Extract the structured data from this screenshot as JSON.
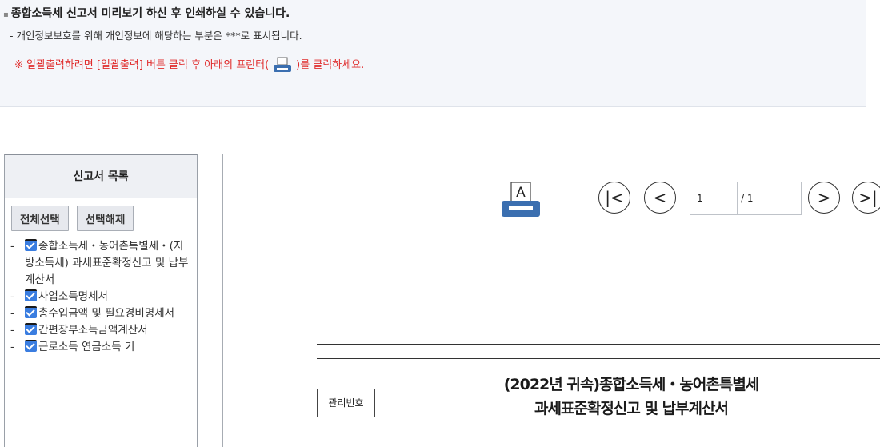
{
  "notice": {
    "bullet": "▪",
    "line1": "종합소득세 신고서 미리보기 하신 후 인쇄하실 수 있습니다.",
    "line2": "- 개인정보보호를 위해 개인정보에 해당하는 부분은  ***로 표시됩니다.",
    "line3_before": "※ 일괄출력하려면 [일괄출력] 버튼 클릭 후 아래의 프린터(",
    "line3_after": ")를 클릭하세요."
  },
  "sidebar": {
    "title": "신고서 목록",
    "select_all": "전체선택",
    "deselect_all": "선택해제",
    "items": [
      {
        "dash": "-",
        "label": "종합소득세・농어촌특별세・(지방소득세) 과세표준확정신고 및 납부계산서"
      },
      {
        "dash": "-",
        "label": "사업소득명세서"
      },
      {
        "dash": "-",
        "label": "총수입금액 및 필요경비명세서"
      },
      {
        "dash": "-",
        "label": "간편장부소득금액계산서"
      },
      {
        "dash": "-",
        "label": "근로소득 연금소득 기"
      }
    ]
  },
  "viewer": {
    "printer_letter": "A",
    "first_page": "|<",
    "prev_page": "<",
    "next_page": ">",
    "last_page": ">|",
    "current_page": "1",
    "total_pages": "/ 1"
  },
  "document": {
    "mgmt_label": "관리번호",
    "mgmt_value": "",
    "title_line1": "(2022년 귀속)종합소득세・농어촌특별세",
    "title_line2": "과세표준확정신고 및 납부계산서"
  },
  "colors": {
    "checkbox": "#3a7de0",
    "notice_red": "#e02c2c",
    "printer_blue": "#3b6fb0"
  }
}
